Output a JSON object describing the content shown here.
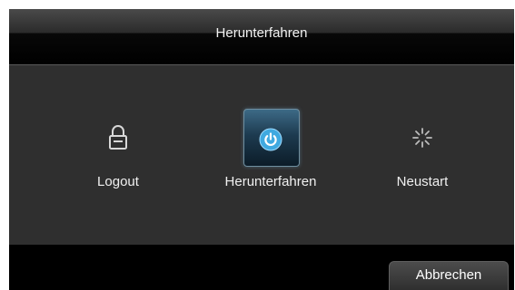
{
  "dialog": {
    "title": "Herunterfahren"
  },
  "options": [
    {
      "label": "Logout",
      "icon": "lock-icon",
      "selected": false
    },
    {
      "label": "Herunterfahren",
      "icon": "power-icon",
      "selected": true
    },
    {
      "label": "Neustart",
      "icon": "spinner-icon",
      "selected": false
    }
  ],
  "footer": {
    "cancel_label": "Abbrechen"
  },
  "colors": {
    "background": "#2f2f2f",
    "titlebar": "#000000",
    "accent": "#3fa9e0"
  }
}
